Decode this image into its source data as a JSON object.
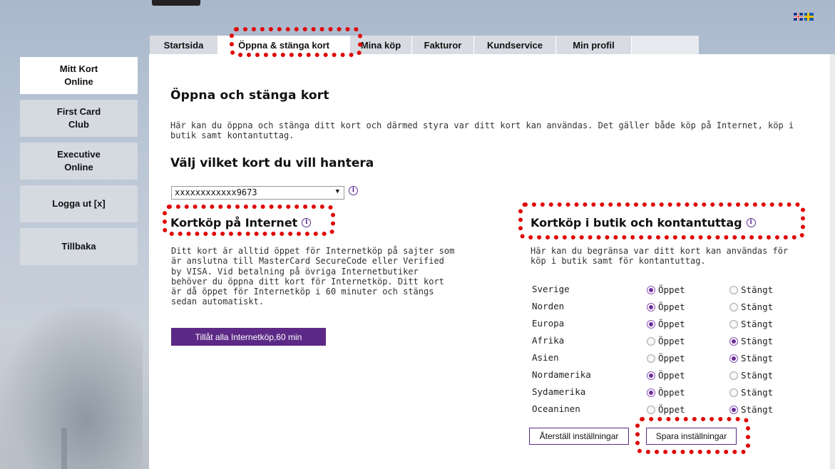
{
  "lang_flags": [
    "uk-flag-icon",
    "sweden-flag-icon"
  ],
  "tabs": [
    {
      "label": "Startsida"
    },
    {
      "label": "Öppna & stänga kort"
    },
    {
      "label": "Mina köp"
    },
    {
      "label": "Fakturor"
    },
    {
      "label": "Kundservice"
    },
    {
      "label": "Min profil"
    }
  ],
  "sidebar": [
    {
      "line1": "Mitt Kort",
      "line2": "Online"
    },
    {
      "line1": "First Card",
      "line2": "Club"
    },
    {
      "line1": "Executive",
      "line2": "Online"
    },
    {
      "line1": "Logga ut [x]",
      "line2": ""
    },
    {
      "line1": "Tillbaka",
      "line2": ""
    }
  ],
  "page": {
    "title": "Öppna och stänga kort",
    "intro": "Här kan du öppna och stänga ditt kort och därmed styra var ditt kort kan användas. Det gäller både köp på Internet, köp i butik samt kontantuttag.",
    "select_heading": "Välj vilket kort du vill hantera",
    "selected_card": "xxxxxxxxxxxx9673"
  },
  "internet": {
    "heading": "Kortköp på Internet",
    "text": "Ditt kort är alltid öppet för Internetköp på sajter som är anslutna till MasterCard SecureCode eller Verified by VISA. Vid betalning på övriga Internetbutiker behöver du öppna ditt kort för Internetköp. Ditt kort är då öppet för Internetköp i 60 minuter och stängs sedan automatiskt.",
    "button": "Tillåt alla Internetköp,60 min"
  },
  "store": {
    "heading": "Kortköp i butik och kontantuttag",
    "text": "Här kan du begränsa var ditt kort kan användas för köp i butik samt för kontantuttag.",
    "open_label": "Öppet",
    "closed_label": "Stängt",
    "regions": [
      {
        "name": "Sverige",
        "state": "open"
      },
      {
        "name": "Norden",
        "state": "open"
      },
      {
        "name": "Europa",
        "state": "open"
      },
      {
        "name": "Afrika",
        "state": "closed"
      },
      {
        "name": "Asien",
        "state": "closed"
      },
      {
        "name": "Nordamerika",
        "state": "open"
      },
      {
        "name": "Sydamerika",
        "state": "open"
      },
      {
        "name": "Oceaninen",
        "state": "closed"
      }
    ],
    "reset_button": "Återställ inställningar",
    "save_button": "Spara inställningar"
  },
  "colors": {
    "accent": "#5c2a86",
    "highlight": "#e10000"
  }
}
